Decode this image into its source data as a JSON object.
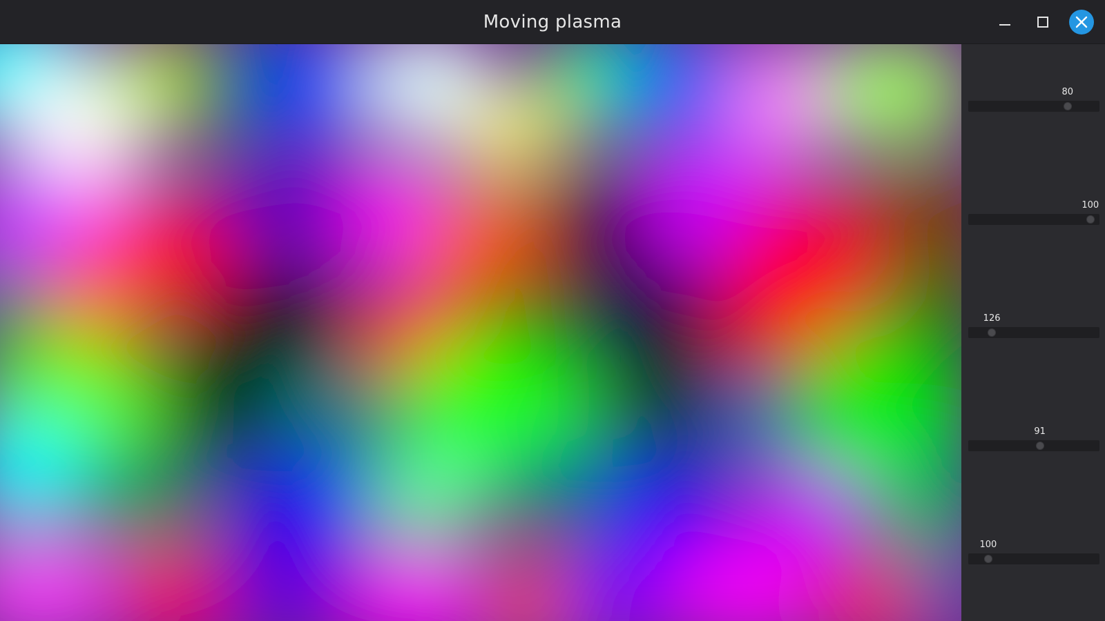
{
  "window": {
    "title": "Moving plasma",
    "controls": {
      "minimize_icon": "minimize-icon",
      "maximize_icon": "maximize-icon",
      "close_icon": "close-icon",
      "close_color": "#2496e2"
    }
  },
  "plasma": {
    "description_colors": [
      "#00ffff",
      "#ffffff",
      "#ff0000",
      "#000000",
      "#00ff00",
      "#0000ff",
      "#ff00ff",
      "#ff8800"
    ]
  },
  "sliders": [
    {
      "value": "80",
      "fraction": 0.78
    },
    {
      "value": "100",
      "fraction": 0.97
    },
    {
      "value": "126",
      "fraction": 0.15
    },
    {
      "value": "91",
      "fraction": 0.55
    },
    {
      "value": "100",
      "fraction": 0.12
    }
  ]
}
